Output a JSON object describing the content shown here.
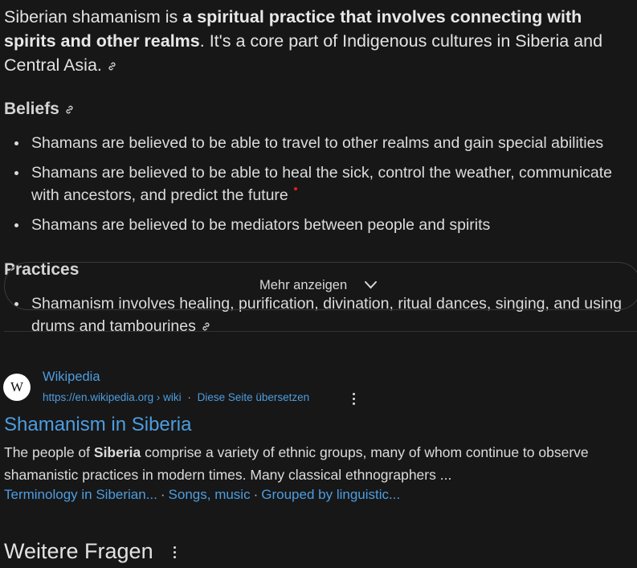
{
  "overview": {
    "intro_start": "Siberian shamanism is ",
    "intro_bold": "a spiritual practice that involves connecting with spirits and other realms",
    "intro_end": ". It's a core part of Indigenous cultures in Siberia and Central Asia."
  },
  "beliefs": {
    "heading": "Beliefs",
    "items": [
      "Shamans are believed to be able to travel to other realms and gain special abilities",
      "Shamans are believed to be able to heal the sick, control the weather, communicate with ancestors, and predict the future",
      "Shamans are believed to be mediators between people and spirits"
    ]
  },
  "practices": {
    "heading": "Practices",
    "items": [
      "Shamanism involves healing, purification, divination, ritual dances, singing, and using drums and tambourines"
    ]
  },
  "show_more": {
    "label": "Mehr anzeigen"
  },
  "result": {
    "logo_letter": "W",
    "site_name": "Wikipedia",
    "url": "https://en.wikipedia.org › wiki",
    "translate": "Diese Seite übersetzen",
    "title": "Shamanism in Siberia",
    "snippet_start": "The people of ",
    "snippet_bold": "Siberia",
    "snippet_end": " comprise a variety of ethnic groups, many of whom continue to observe shamanistic practices in modern times. Many classical ethnographers ...",
    "sitelinks": [
      "Terminology in Siberian...",
      "Songs, music",
      "Grouped by linguistic..."
    ]
  },
  "more_questions": {
    "heading": "Weitere Fragen"
  },
  "colors": {
    "background": "#171717",
    "link": "#4d9de0",
    "text": "#e3e3e3",
    "marker": "#e02020"
  },
  "icons": [
    "link-icon",
    "chevron-down-icon",
    "kebab-menu-icon",
    "wikipedia-logo"
  ]
}
